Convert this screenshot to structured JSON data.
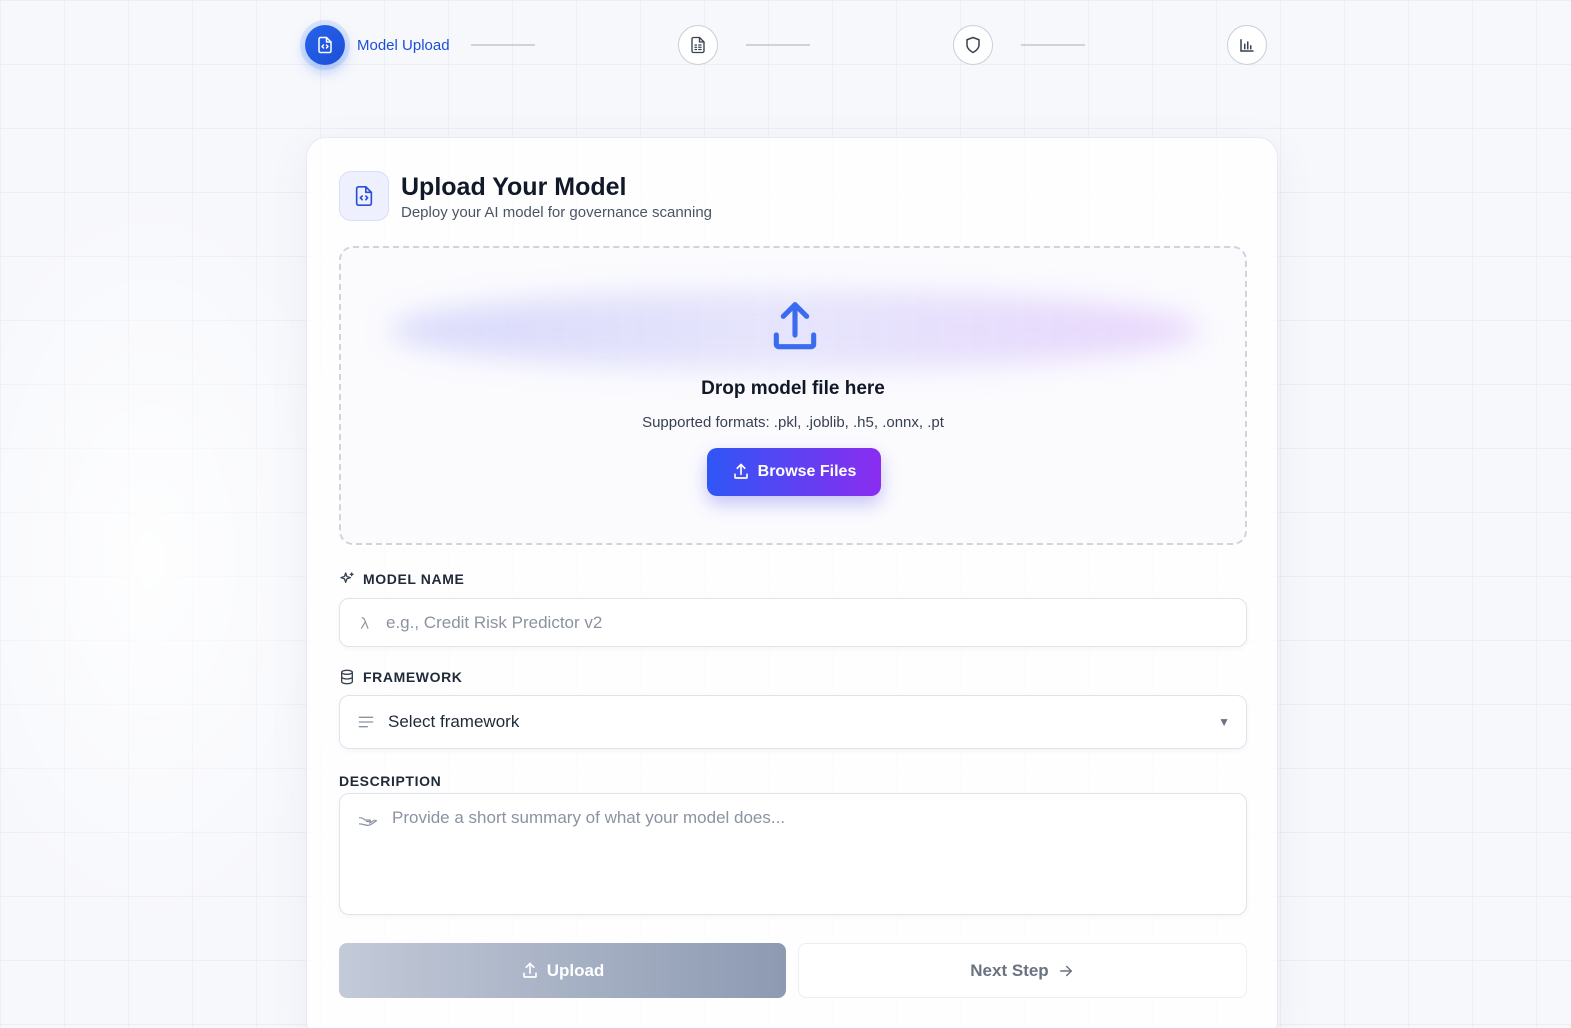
{
  "stepper": {
    "steps": [
      {
        "label": "Model Upload",
        "icon": "file-code-icon",
        "active": true
      },
      {
        "label": "",
        "icon": "file-spreadsheet-icon",
        "active": false
      },
      {
        "label": "",
        "icon": "shield-icon",
        "active": false
      },
      {
        "label": "",
        "icon": "bar-chart-icon",
        "active": false
      }
    ]
  },
  "card": {
    "title": "Upload Your Model",
    "subtitle": "Deploy your AI model for governance scanning",
    "icon": "file-code-icon"
  },
  "dropzone": {
    "title": "Drop model file here",
    "formats": "Supported formats: .pkl, .joblib, .h5, .onnx, .pt",
    "browse_label": "Browse Files"
  },
  "fields": {
    "model_name": {
      "label": "MODEL NAME",
      "placeholder": "e.g., Credit Risk Predictor v2",
      "value": ""
    },
    "framework": {
      "label": "FRAMEWORK",
      "selected": "Select framework"
    },
    "description": {
      "label": "DESCRIPTION",
      "placeholder": "Provide a short summary of what your model does...",
      "value": ""
    }
  },
  "actions": {
    "upload_label": "Upload",
    "next_label": "Next Step"
  },
  "colors": {
    "accent": "#2563eb",
    "gradient_start": "#2f56f6",
    "gradient_end": "#8b2cf0"
  }
}
